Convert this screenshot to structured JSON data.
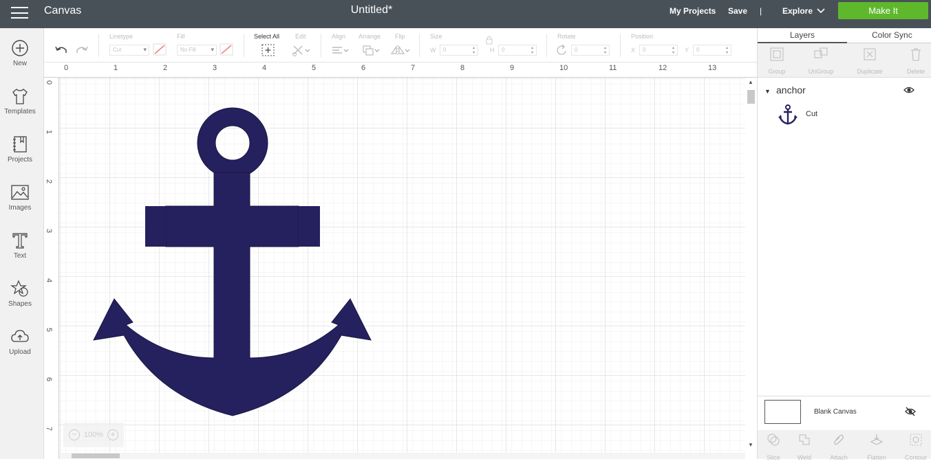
{
  "topbar": {
    "app_title": "Canvas",
    "doc_title": "Untitled*",
    "my_projects": "My Projects",
    "save": "Save",
    "divider": "|",
    "machine": "Explore",
    "make_it": "Make It"
  },
  "sidebar": {
    "items": [
      {
        "label": "New",
        "icon": "plus-circle-icon"
      },
      {
        "label": "Templates",
        "icon": "tshirt-icon"
      },
      {
        "label": "Projects",
        "icon": "notebook-icon"
      },
      {
        "label": "Images",
        "icon": "image-icon"
      },
      {
        "label": "Text",
        "icon": "text-icon"
      },
      {
        "label": "Shapes",
        "icon": "shapes-icon"
      },
      {
        "label": "Upload",
        "icon": "cloud-upload-icon"
      }
    ]
  },
  "toolbar": {
    "linetype_label": "Linetype",
    "linetype_value": "Cut",
    "fill_label": "Fill",
    "fill_value": "No Fill",
    "select_all_label": "Select All",
    "edit_label": "Edit",
    "align_label": "Align",
    "arrange_label": "Arrange",
    "flip_label": "Flip",
    "size_label": "Size",
    "w_label": "W",
    "w_value": "0",
    "h_label": "H",
    "h_value": "0",
    "rotate_label": "Rotate",
    "rotate_value": "0",
    "position_label": "Position",
    "x_label": "X",
    "x_value": "0",
    "y_label": "Y",
    "y_value": "0"
  },
  "canvas": {
    "ruler_top": [
      "0",
      "1",
      "2",
      "3",
      "4",
      "5",
      "6",
      "7",
      "8",
      "9",
      "10",
      "11",
      "12",
      "13"
    ],
    "ruler_left": [
      "0",
      "1",
      "2",
      "3",
      "4",
      "5",
      "6",
      "7"
    ],
    "zoom_minus": "−",
    "zoom_level": "100%",
    "zoom_plus": "+",
    "colors": {
      "anchor": "#25215e",
      "grid_major": "#cfcfcf",
      "grid_minor": "#ececec"
    }
  },
  "layers_panel": {
    "tabs": [
      "Layers",
      "Color Sync"
    ],
    "tools": [
      "Group",
      "UnGroup",
      "Duplicate",
      "Delete"
    ],
    "group_name": "anchor",
    "item_operation": "Cut",
    "blank_canvas": "Blank Canvas",
    "bottom_tools": [
      "Slice",
      "Weld",
      "Attach",
      "Flatten",
      "Contour"
    ]
  },
  "colors": {
    "topbar": "#495158",
    "make_it": "#5fb82c"
  }
}
